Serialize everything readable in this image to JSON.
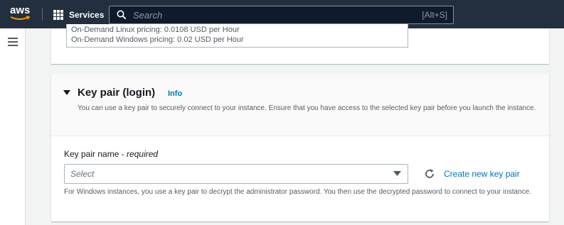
{
  "nav": {
    "logo_text": "aws",
    "services_label": "Services",
    "search_placeholder": "Search",
    "search_shortcut": "[Alt+S]"
  },
  "pricing": {
    "linux_line": "On-Demand Linux pricing: 0.0108 USD per Hour",
    "windows_line": "On-Demand Windows pricing: 0.02 USD per Hour"
  },
  "key_pair": {
    "title": "Key pair (login)",
    "info_label": "Info",
    "description": "You can use a key pair to securely connect to your instance. Ensure that you have access to the selected key pair before you launch the instance.",
    "field_label": "Key pair name - ",
    "field_required": "required",
    "select_placeholder": "Select",
    "create_label": "Create new key pair",
    "hint": "For Windows instances, you use a key pair to decrypt the administrator password. You then use the decrypted password to connect to your instance."
  },
  "colors": {
    "nav_bg": "#232f3e",
    "link": "#0073bb",
    "aws_orange": "#ff9900"
  },
  "icons": [
    "services-grid-icon",
    "search-icon",
    "hamburger-icon",
    "caret-down-icon",
    "dropdown-arrow-icon",
    "refresh-icon"
  ]
}
